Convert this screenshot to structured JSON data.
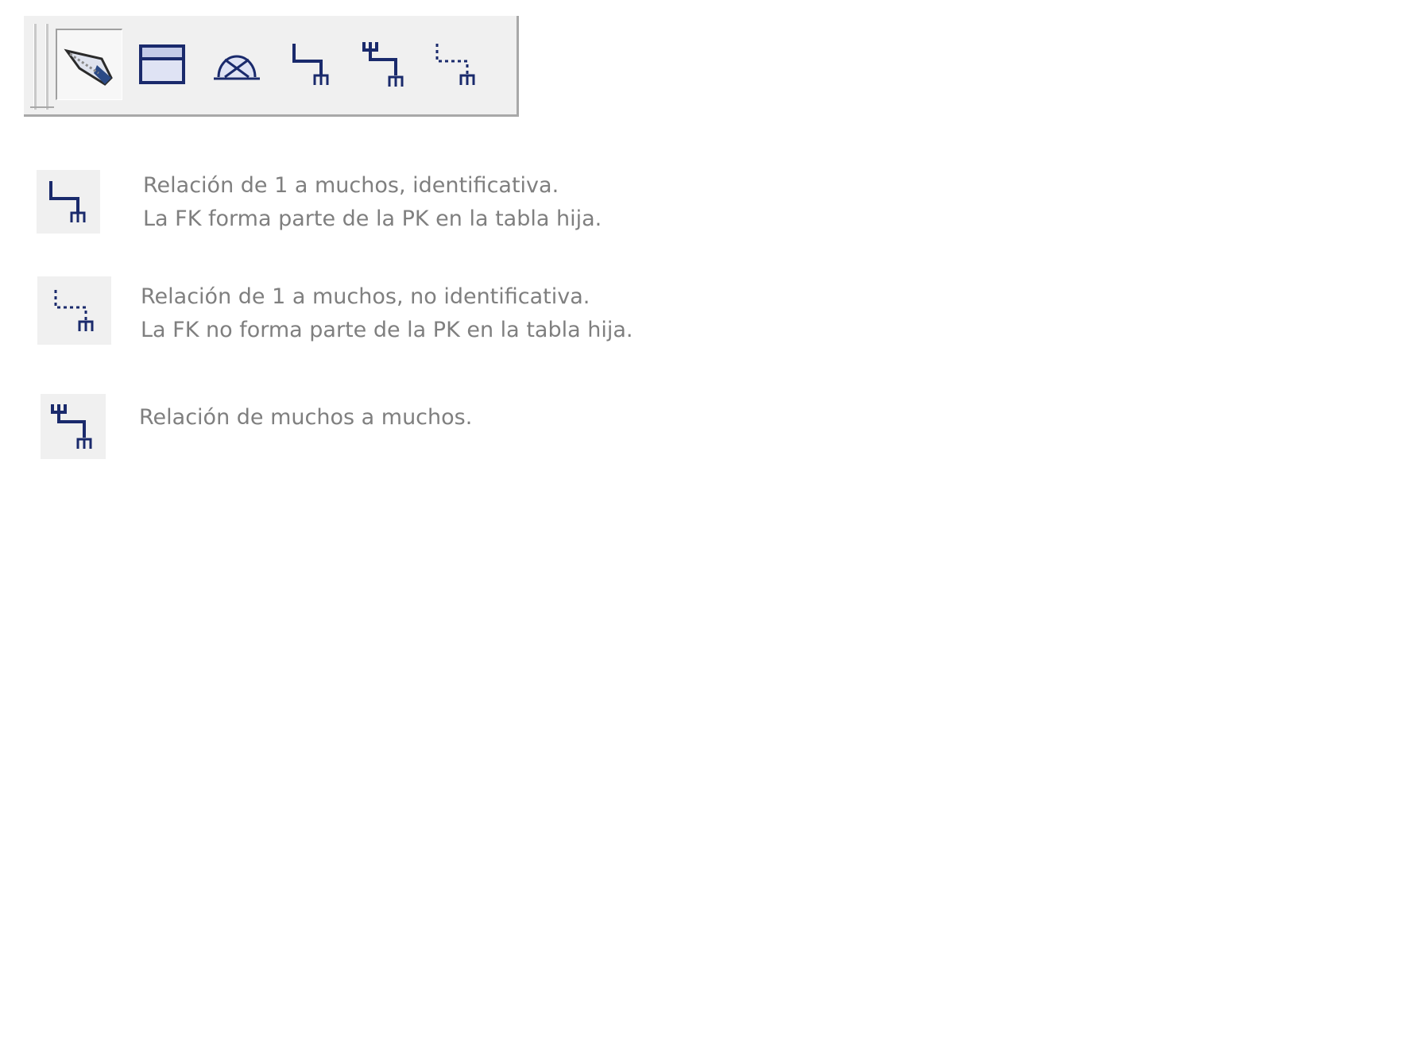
{
  "toolbar": {
    "tools": [
      {
        "icon": "select-pointer-icon",
        "selected": true
      },
      {
        "icon": "entity-table-icon",
        "selected": false
      },
      {
        "icon": "view-icon",
        "selected": false
      },
      {
        "icon": "one-to-many-identifying-icon",
        "selected": false
      },
      {
        "icon": "many-to-many-icon",
        "selected": false
      },
      {
        "icon": "one-to-many-non-identifying-icon",
        "selected": false
      }
    ]
  },
  "legend": {
    "identifying": {
      "icon": "one-to-many-identifying-icon",
      "line1": "Relación de 1 a muchos, identificativa.",
      "line2": "La FK forma parte de la PK en la tabla hija."
    },
    "non_identifying": {
      "icon": "one-to-many-non-identifying-icon",
      "line1": "Relación de 1 a muchos, no identificativa.",
      "line2": "La FK no forma parte de la PK en la tabla hija."
    },
    "many_to_many": {
      "icon": "many-to-many-icon",
      "line1": "Relación de muchos a muchos."
    }
  },
  "colors": {
    "icon_navy": "#1a2a6c",
    "text_gray": "#7f7f7f",
    "toolbar_bg": "#f0f0f0"
  }
}
